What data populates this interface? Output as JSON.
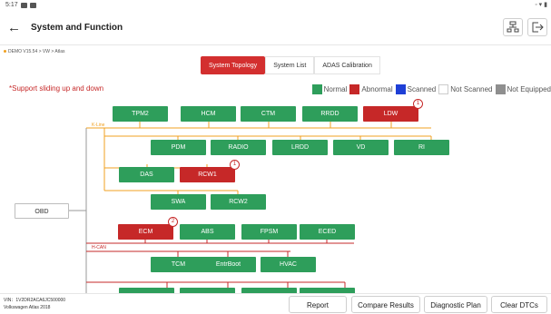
{
  "status": {
    "time": "5:17",
    "right": "◦ ▾ ▮"
  },
  "header": {
    "title": "System and Function"
  },
  "breadcrumb": "DEMO V15.54 > VW > Atlas",
  "tabs": [
    {
      "label": "System Topology",
      "active": true
    },
    {
      "label": "System List",
      "active": false
    },
    {
      "label": "ADAS Calibration",
      "active": false
    }
  ],
  "support_note": "*Support sliding up and down",
  "legend": [
    {
      "label": "Normal",
      "color": "#2e9e5b"
    },
    {
      "label": "Abnormal",
      "color": "#c62828"
    },
    {
      "label": "Scanned",
      "color": "#1e3fd6"
    },
    {
      "label": "Not Scanned",
      "color": "#ffffff"
    },
    {
      "label": "Not Equipped",
      "color": "#8f8f8f"
    }
  ],
  "topology": {
    "root": "OBD",
    "buses": [
      {
        "label": "K-Line",
        "color": "#f0a020"
      },
      {
        "label": "H-CAN",
        "color": "#c62828"
      }
    ],
    "modules": [
      {
        "label": "TPM2",
        "state": "normal"
      },
      {
        "label": "HCM",
        "state": "normal"
      },
      {
        "label": "CTM",
        "state": "normal"
      },
      {
        "label": "RRDD",
        "state": "normal"
      },
      {
        "label": "LDW",
        "state": "abnormal",
        "badge": "1"
      },
      {
        "label": "PDM",
        "state": "normal"
      },
      {
        "label": "RADIO",
        "state": "normal"
      },
      {
        "label": "LRDD",
        "state": "normal"
      },
      {
        "label": "VD",
        "state": "normal"
      },
      {
        "label": "RI",
        "state": "normal"
      },
      {
        "label": "DAS",
        "state": "normal"
      },
      {
        "label": "RCW1",
        "state": "abnormal",
        "badge": "1"
      },
      {
        "label": "SWA",
        "state": "normal"
      },
      {
        "label": "RCW2",
        "state": "normal"
      },
      {
        "label": "ECM",
        "state": "abnormal",
        "badge": "2"
      },
      {
        "label": "ABS",
        "state": "normal"
      },
      {
        "label": "FPSM",
        "state": "normal"
      },
      {
        "label": "ECED",
        "state": "normal"
      },
      {
        "label": "TCM",
        "state": "normal"
      },
      {
        "label": "EntrBoot",
        "state": "normal"
      },
      {
        "label": "HVAC",
        "state": "normal"
      }
    ]
  },
  "vehicle": {
    "vin": "VIN：1V2DR2ACA6JC500000",
    "model": "Volkswagen Atlas 2018"
  },
  "footer_buttons": [
    "Report",
    "Compare Results",
    "Diagnostic Plan",
    "Clear DTCs"
  ]
}
